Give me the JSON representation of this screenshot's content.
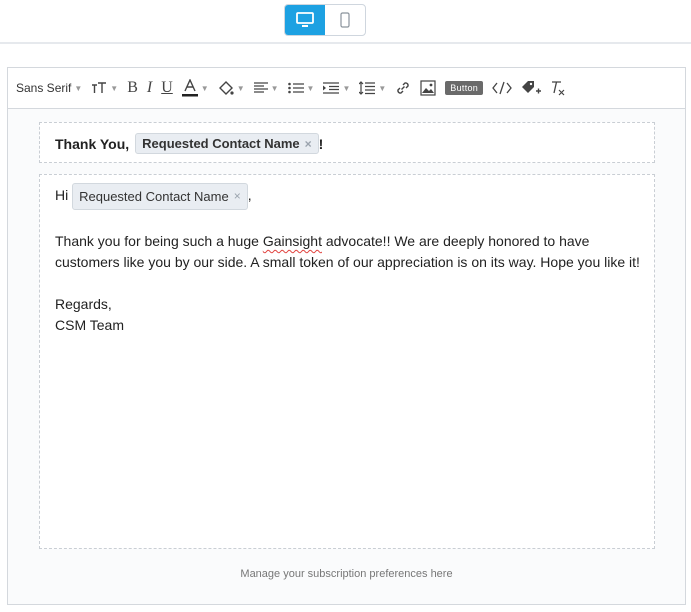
{
  "device_toggle": {
    "active": "desktop"
  },
  "toolbar": {
    "font_family": "Sans Serif",
    "button_label": "Button"
  },
  "subject": {
    "prefix": "Thank You,",
    "token": "Requested Contact Name",
    "suffix": "!"
  },
  "body": {
    "greeting_prefix": "Hi",
    "greeting_token": "Requested Contact Name",
    "greeting_suffix": ",",
    "para_start": "Thank you for being such a huge ",
    "misspelled_word": "Gainsight",
    "para_end": " advocate!! We are deeply honored to have customers like you by our side. A small token of our appreciation is on its way. Hope you like it!",
    "closing": "Regards,",
    "signature": "CSM Team"
  },
  "footer": {
    "text": "Manage your subscription preferences here"
  },
  "colors": {
    "accent": "#1da1e2",
    "spellcheck": "#e0413d"
  }
}
